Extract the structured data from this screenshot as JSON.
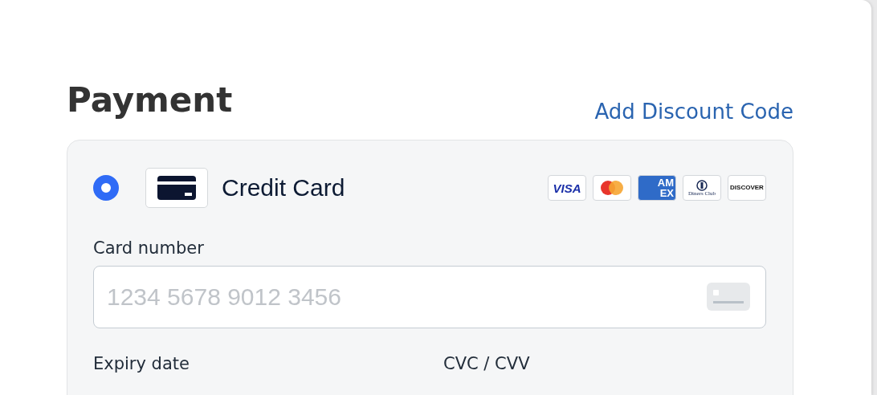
{
  "heading": "Payment",
  "discount_link": "Add Discount Code",
  "payment_method": {
    "label": "Credit Card",
    "selected": true,
    "brands": [
      {
        "kind": "visa",
        "lines": [
          "VISA"
        ]
      },
      {
        "kind": "mastercard"
      },
      {
        "kind": "amex",
        "lines": [
          "AM",
          "EX"
        ]
      },
      {
        "kind": "diners",
        "lines": [
          "Diners Club"
        ]
      },
      {
        "kind": "discover",
        "lines": [
          "DISCOVER"
        ]
      }
    ]
  },
  "card_number": {
    "label": "Card number",
    "placeholder": "1234 5678 9012 3456"
  },
  "fields": [
    {
      "label": "Expiry date"
    },
    {
      "label": "CVC / CVV"
    }
  ]
}
